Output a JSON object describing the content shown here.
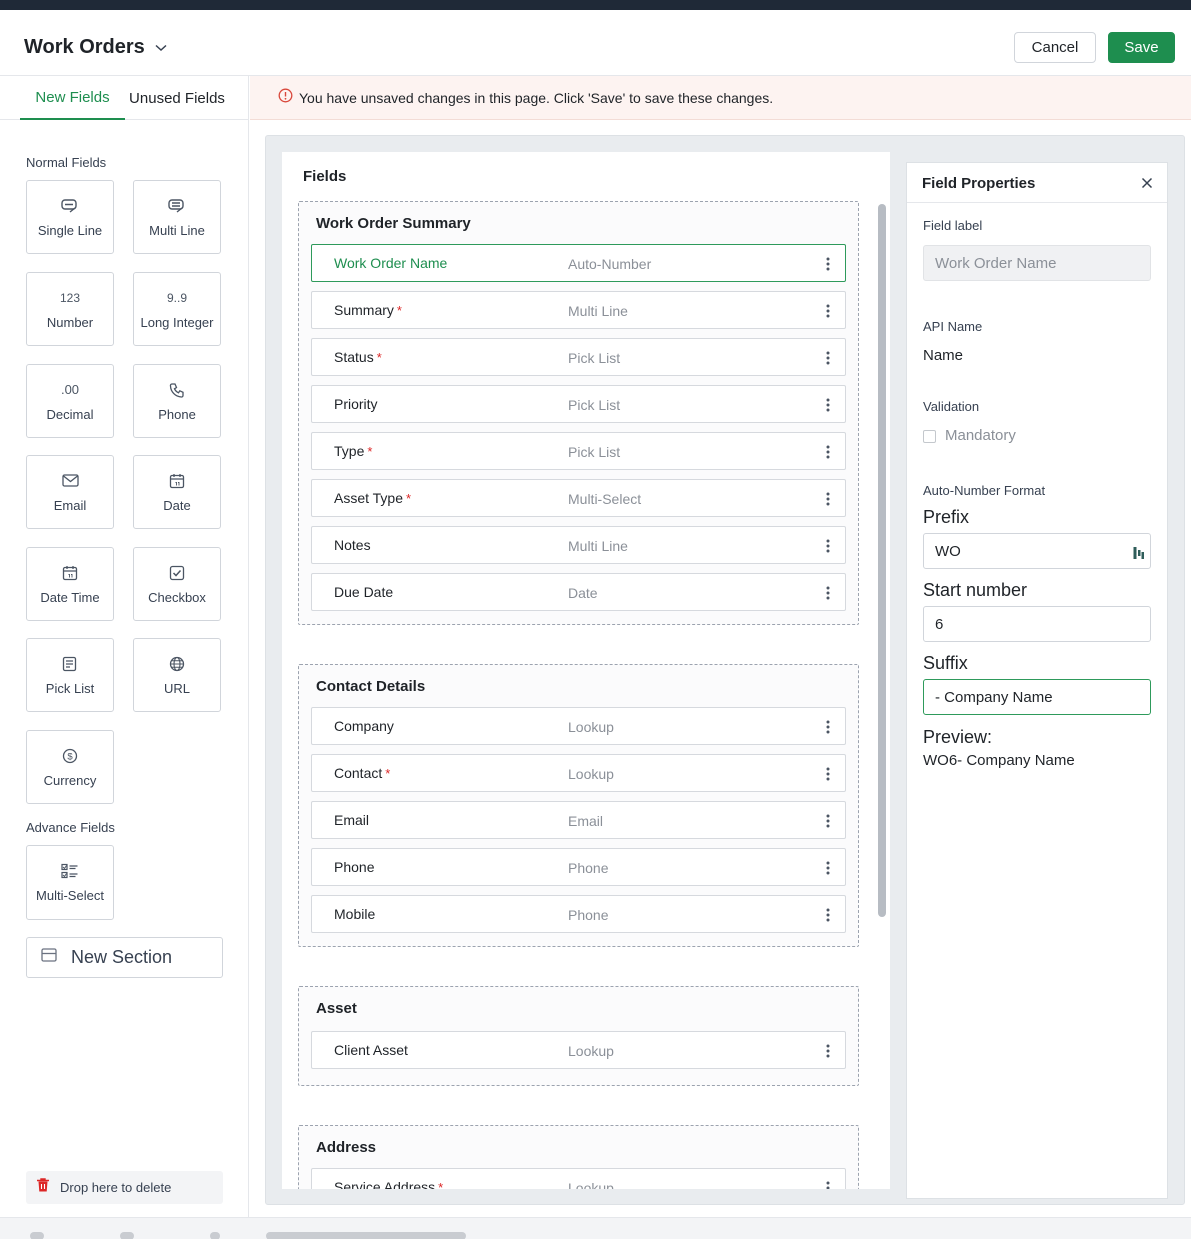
{
  "header": {
    "title": "Work Orders",
    "cancel_label": "Cancel",
    "save_label": "Save"
  },
  "tabs": {
    "new": "New Fields",
    "unused": "Unused Fields"
  },
  "palette": {
    "normal_label": "Normal Fields",
    "advance_label": "Advance Fields",
    "tiles": [
      {
        "label": "Single Line",
        "icon": "single-line-icon"
      },
      {
        "label": "Multi Line",
        "icon": "multi-line-icon"
      },
      {
        "label": "Number",
        "glyph": "123",
        "icon": "number-icon"
      },
      {
        "label": "Long Integer",
        "glyph": "9..9",
        "icon": "long-integer-icon"
      },
      {
        "label": "Decimal",
        "glyph": ".00",
        "icon": "decimal-icon"
      },
      {
        "label": "Phone",
        "icon": "phone-icon"
      },
      {
        "label": "Email",
        "icon": "email-icon"
      },
      {
        "label": "Date",
        "icon": "date-icon"
      },
      {
        "label": "Date Time",
        "icon": "date-time-icon"
      },
      {
        "label": "Checkbox",
        "icon": "checkbox-icon"
      },
      {
        "label": "Pick List",
        "icon": "pick-list-icon"
      },
      {
        "label": "URL",
        "icon": "globe-icon"
      },
      {
        "label": "Currency",
        "icon": "currency-icon"
      }
    ],
    "advance_tiles": [
      {
        "label": "Multi-Select",
        "icon": "multi-select-icon"
      }
    ],
    "new_section": "New Section",
    "drop_delete": "Drop here to delete"
  },
  "banner": {
    "text": "You have unsaved changes in this page. Click 'Save' to save these changes."
  },
  "fields": {
    "title": "Fields",
    "sections": [
      {
        "title": "Work Order Summary",
        "rows": [
          {
            "name": "Work Order Name",
            "type": "Auto-Number",
            "required": false,
            "active": true
          },
          {
            "name": "Summary",
            "type": "Multi Line",
            "required": true
          },
          {
            "name": "Status",
            "type": "Pick List",
            "required": true
          },
          {
            "name": "Priority",
            "type": "Pick List",
            "required": false
          },
          {
            "name": "Type",
            "type": "Pick List",
            "required": true
          },
          {
            "name": "Asset Type",
            "type": "Multi-Select",
            "required": true
          },
          {
            "name": "Notes",
            "type": "Multi Line",
            "required": false
          },
          {
            "name": "Due Date",
            "type": "Date",
            "required": false
          }
        ]
      },
      {
        "title": "Contact Details",
        "rows": [
          {
            "name": "Company",
            "type": "Lookup",
            "required": false
          },
          {
            "name": "Contact",
            "type": "Lookup",
            "required": true
          },
          {
            "name": "Email",
            "type": "Email",
            "required": false
          },
          {
            "name": "Phone",
            "type": "Phone",
            "required": false
          },
          {
            "name": "Mobile",
            "type": "Phone",
            "required": false
          }
        ]
      },
      {
        "title": "Asset",
        "rows": [
          {
            "name": "Client Asset",
            "type": "Lookup",
            "required": false
          }
        ]
      },
      {
        "title": "Address",
        "rows": [
          {
            "name": "Service Address",
            "type": "Lookup",
            "required": true
          }
        ]
      }
    ]
  },
  "properties": {
    "title": "Field Properties",
    "field_label_label": "Field label",
    "field_label_value": "Work Order Name",
    "api_name_label": "API Name",
    "api_name_value": "Name",
    "validation_label": "Validation",
    "mandatory_label": "Mandatory",
    "mandatory_checked": false,
    "autonumber_label": "Auto-Number Format",
    "prefix_label": "Prefix",
    "prefix_value": "WO",
    "start_label": "Start number",
    "start_value": "6",
    "suffix_label": "Suffix",
    "suffix_value": "- Company Name",
    "preview_label": "Preview:",
    "preview_value": "WO6- Company Name"
  },
  "colors": {
    "accent": "#1e8e4f",
    "required": "#dc2626",
    "banner_bg": "#fdf3f1",
    "info": "#d9473b"
  }
}
